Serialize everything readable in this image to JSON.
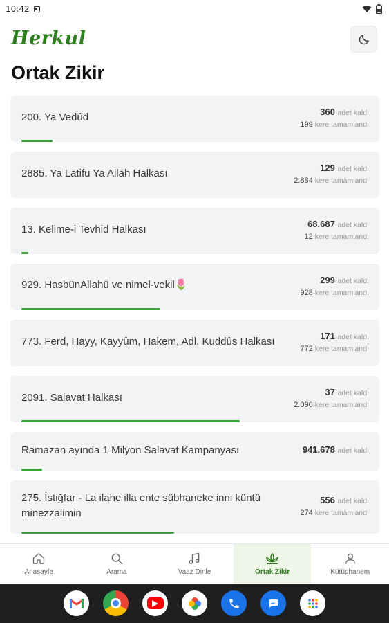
{
  "status_bar": {
    "time": "10:42"
  },
  "app": {
    "logo": "Herkul"
  },
  "page": {
    "title": "Ortak Zikir"
  },
  "labels": {
    "remaining": "adet kaldı",
    "completed": "kere tamamlandı"
  },
  "items": [
    {
      "title": "200. Ya Vedûd",
      "remaining": "360",
      "completed": "199",
      "progress": 0.09
    },
    {
      "title": "2885. Ya Latifu Ya Allah Halkası",
      "remaining": "129",
      "completed": "2.884",
      "progress": 0.0
    },
    {
      "title": "13. Kelime-i Tevhid Halkası",
      "remaining": "68.687",
      "completed": "12",
      "progress": 0.02
    },
    {
      "title": "929. HasbünAllahü ve nimel-vekil🌷",
      "remaining": "299",
      "completed": "928",
      "progress": 0.4
    },
    {
      "title": "773. Ferd, Hayy, Kayyûm, Hakem, Adl, Kuddûs Halkası",
      "remaining": "171",
      "completed": "772",
      "progress": 0.0
    },
    {
      "title": "2091. Salavat Halkası",
      "remaining": "37",
      "completed": "2.090",
      "progress": 0.63
    },
    {
      "title": "Ramazan ayında 1 Milyon Salavat Kampanyası",
      "remaining": "941.678",
      "completed": "",
      "progress": 0.06
    },
    {
      "title_line1": "275. İstiğfar - La ilahe illa ente sübhaneke inni küntü",
      "title_line2": "minezzalimin",
      "remaining": "556",
      "completed": "274",
      "progress": 0.44
    }
  ],
  "nav": [
    {
      "label": "Anasayfa",
      "icon": "home-icon",
      "active": false
    },
    {
      "label": "Arama",
      "icon": "search-icon",
      "active": false
    },
    {
      "label": "Vaaz Dinle",
      "icon": "music-note-icon",
      "active": false
    },
    {
      "label": "Ortak Zikir",
      "icon": "lotus-icon",
      "active": true
    },
    {
      "label": "Kütüphanem",
      "icon": "user-icon",
      "active": false
    }
  ],
  "dock": [
    {
      "icon": "gmail-icon",
      "glyph": "M",
      "color": "#ffffff"
    },
    {
      "icon": "chrome-icon",
      "glyph": "",
      "color": "#ea4335"
    },
    {
      "icon": "youtube-icon",
      "glyph": "▶",
      "color": "#ffffff"
    },
    {
      "icon": "photos-icon",
      "glyph": "✿",
      "color": "#ffffff"
    },
    {
      "icon": "phone-icon",
      "glyph": "✆",
      "color": "#1a73e8"
    },
    {
      "icon": "messages-icon",
      "glyph": "▤",
      "color": "#1a73e8"
    },
    {
      "icon": "apps-icon",
      "glyph": "⁞⁞",
      "color": "#ffffff"
    }
  ],
  "colors": {
    "accent": "#3aa13a",
    "logo": "#2e7d1f",
    "card_bg": "#f2f3f4"
  }
}
